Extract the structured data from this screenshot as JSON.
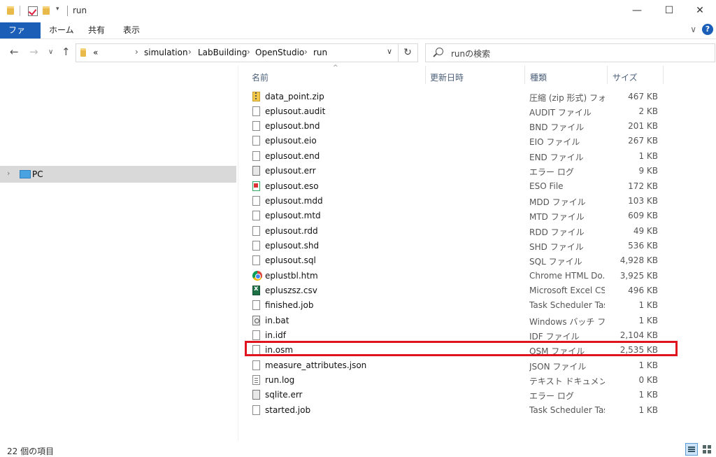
{
  "window": {
    "title": "run",
    "minimize": "—",
    "maximize": "☐",
    "close": "✕"
  },
  "ribbon": {
    "tabs": [
      "ファイル",
      "ホーム",
      "共有",
      "表示"
    ],
    "expand_glyph": "∨",
    "help_glyph": "?"
  },
  "nav": {
    "back": "←",
    "forward": "→",
    "recent": "∨",
    "up": "↑",
    "address": {
      "overflow": "«",
      "crumbs": [
        "simulation",
        "LabBuilding",
        "OpenStudio",
        "run"
      ],
      "separator": "›",
      "dropdown": "∨"
    },
    "refresh": "↻",
    "search_placeholder": "runの検索"
  },
  "navpane": {
    "items": [
      {
        "label": "PC",
        "chevron": "›"
      }
    ]
  },
  "columns": {
    "name": "名前",
    "date": "更新日時",
    "type": "種類",
    "size": "サイズ",
    "sort_glyph": "^"
  },
  "files": [
    {
      "name": "data_point.zip",
      "type": "圧縮 (zip 形式) フォ...",
      "size": "467 KB",
      "icon": "zip"
    },
    {
      "name": "eplusout.audit",
      "type": "AUDIT ファイル",
      "size": "2 KB",
      "icon": "file"
    },
    {
      "name": "eplusout.bnd",
      "type": "BND ファイル",
      "size": "201 KB",
      "icon": "file"
    },
    {
      "name": "eplusout.eio",
      "type": "EIO ファイル",
      "size": "267 KB",
      "icon": "file"
    },
    {
      "name": "eplusout.end",
      "type": "END ファイル",
      "size": "1 KB",
      "icon": "file"
    },
    {
      "name": "eplusout.err",
      "type": "エラー ログ",
      "size": "9 KB",
      "icon": "err"
    },
    {
      "name": "eplusout.eso",
      "type": "ESO File",
      "size": "172 KB",
      "icon": "eso"
    },
    {
      "name": "eplusout.mdd",
      "type": "MDD ファイル",
      "size": "103 KB",
      "icon": "file"
    },
    {
      "name": "eplusout.mtd",
      "type": "MTD ファイル",
      "size": "609 KB",
      "icon": "file"
    },
    {
      "name": "eplusout.rdd",
      "type": "RDD ファイル",
      "size": "49 KB",
      "icon": "file"
    },
    {
      "name": "eplusout.shd",
      "type": "SHD ファイル",
      "size": "536 KB",
      "icon": "file"
    },
    {
      "name": "eplusout.sql",
      "type": "SQL ファイル",
      "size": "4,928 KB",
      "icon": "file"
    },
    {
      "name": "eplustbl.htm",
      "type": "Chrome HTML Do...",
      "size": "3,925 KB",
      "icon": "chrome"
    },
    {
      "name": "epluszsz.csv",
      "type": "Microsoft Excel CS...",
      "size": "496 KB",
      "icon": "excel"
    },
    {
      "name": "finished.job",
      "type": "Task Scheduler Tas...",
      "size": "1 KB",
      "icon": "file"
    },
    {
      "name": "in.bat",
      "type": "Windows バッチ ファ...",
      "size": "1 KB",
      "icon": "bat"
    },
    {
      "name": "in.idf",
      "type": "IDF ファイル",
      "size": "2,104 KB",
      "icon": "file"
    },
    {
      "name": "in.osm",
      "type": "OSM ファイル",
      "size": "2,535 KB",
      "icon": "file"
    },
    {
      "name": "measure_attributes.json",
      "type": "JSON ファイル",
      "size": "1 KB",
      "icon": "file"
    },
    {
      "name": "run.log",
      "type": "テキスト ドキュメント",
      "size": "0 KB",
      "icon": "log"
    },
    {
      "name": "sqlite.err",
      "type": "エラー ログ",
      "size": "1 KB",
      "icon": "err"
    },
    {
      "name": "started.job",
      "type": "Task Scheduler Tas...",
      "size": "1 KB",
      "icon": "file"
    }
  ],
  "highlighted_file": "in.osm",
  "highlight_color": "#e0141e",
  "accent_color": "#1a5eb8",
  "status": {
    "item_count": "22 個の項目"
  }
}
